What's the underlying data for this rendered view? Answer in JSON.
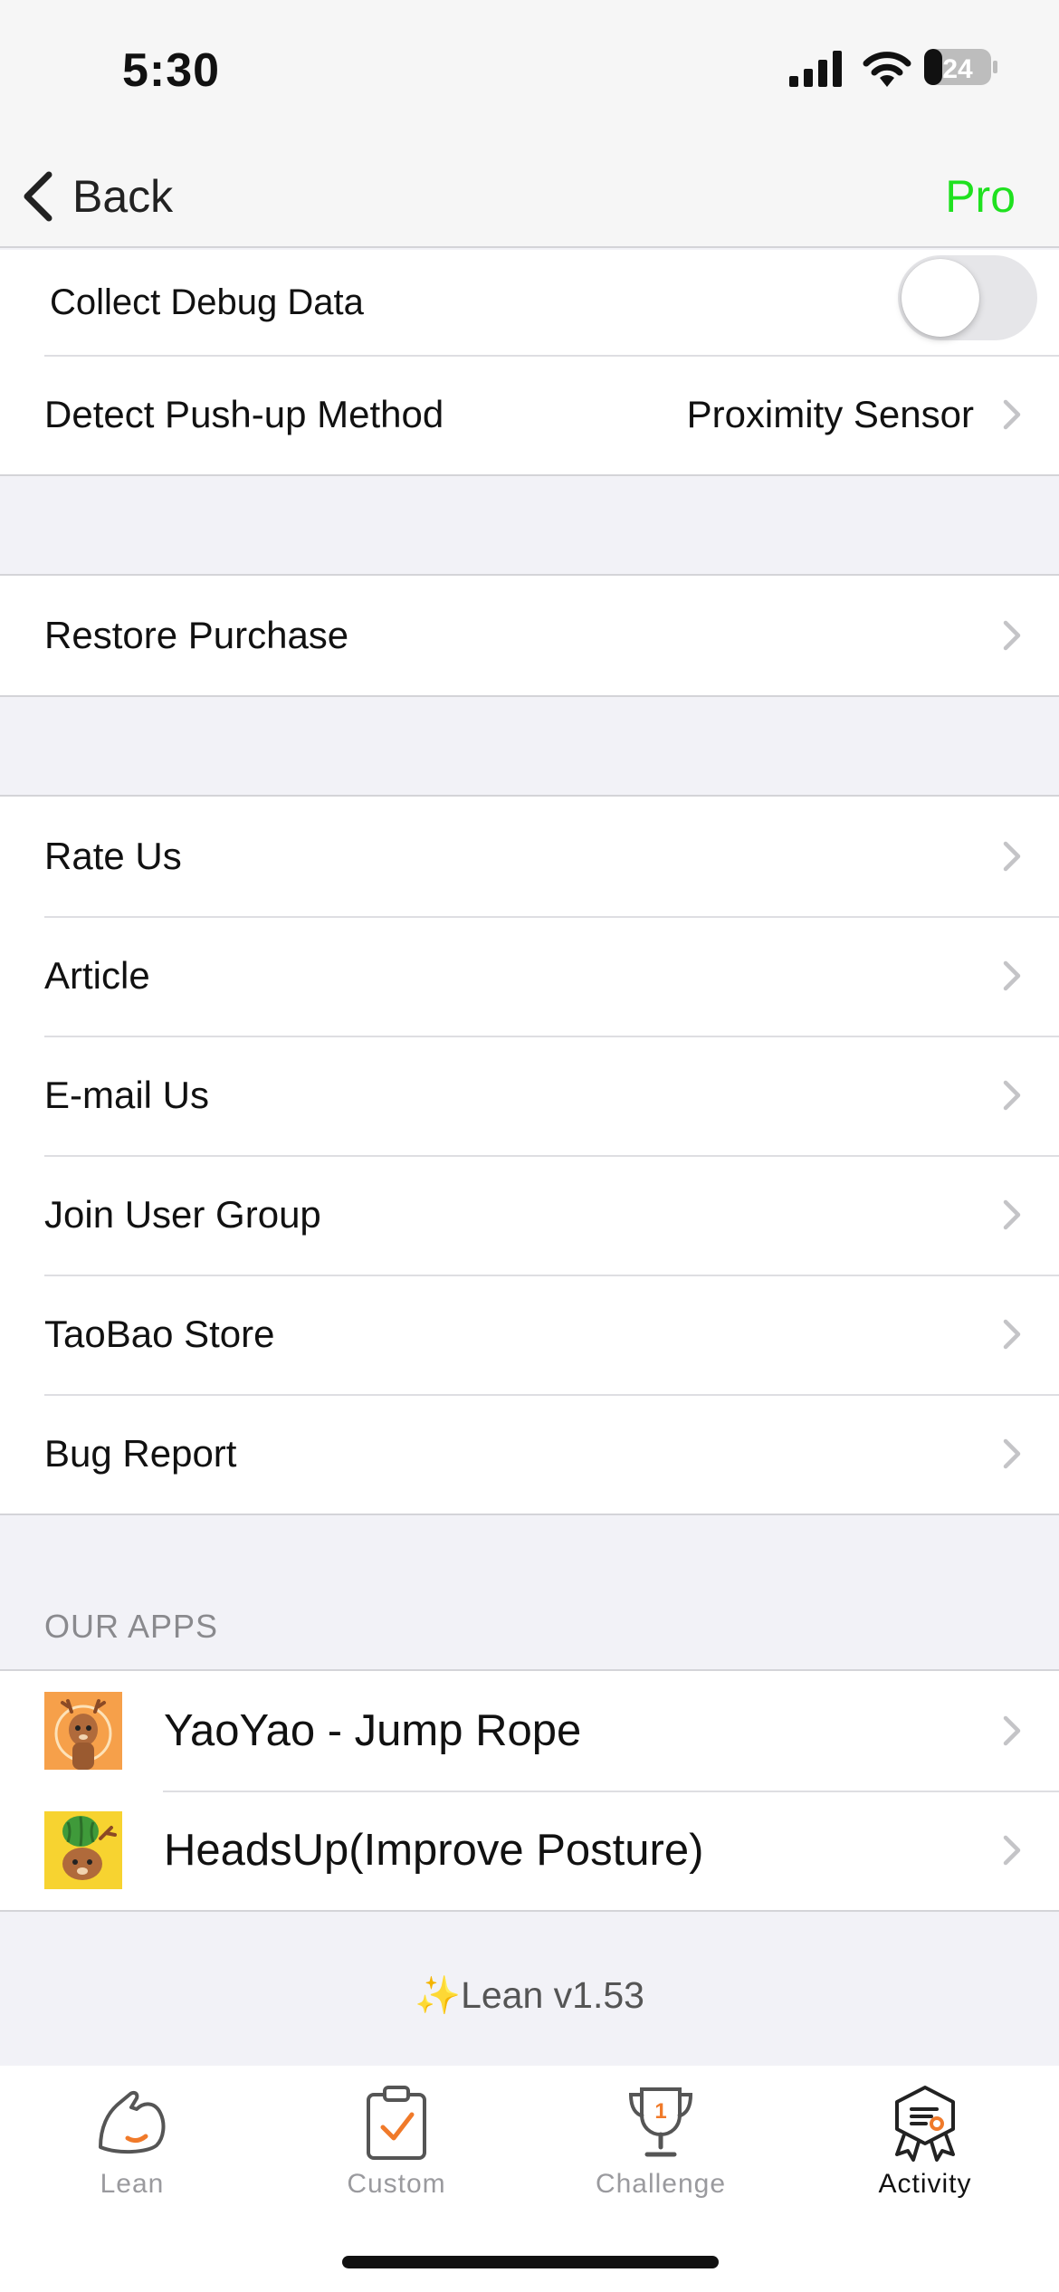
{
  "status_bar": {
    "time": "5:30",
    "battery": "24"
  },
  "nav": {
    "back_label": "Back",
    "pro_label": "Pro"
  },
  "settings": {
    "collect_debug": {
      "label": "Collect Debug Data",
      "enabled": false
    },
    "detect_method": {
      "label": "Detect Push-up Method",
      "value": "Proximity Sensor"
    },
    "restore_purchase": "Restore Purchase",
    "support_items": [
      "Rate Us",
      "Article",
      "E-mail Us",
      "Join User Group",
      "TaoBao Store",
      "Bug Report"
    ]
  },
  "our_apps": {
    "header": "OUR APPS",
    "apps": [
      {
        "name": "YaoYao - Jump Rope",
        "icon": "deer-jump-rope-icon"
      },
      {
        "name": "HeadsUp(Improve Posture)",
        "icon": "deer-watermelon-icon"
      }
    ]
  },
  "version": "✨Lean v1.53",
  "tabs": [
    {
      "label": "Lean",
      "icon": "flexed-arm-icon",
      "active": false
    },
    {
      "label": "Custom",
      "icon": "clipboard-check-icon",
      "active": false
    },
    {
      "label": "Challenge",
      "icon": "trophy-icon",
      "active": false
    },
    {
      "label": "Activity",
      "icon": "activity-badge-icon",
      "active": true
    }
  ],
  "colors": {
    "accent_pro": "#1fe11f",
    "tab_accent": "#f07a2a",
    "background": "#f2f2f7"
  }
}
